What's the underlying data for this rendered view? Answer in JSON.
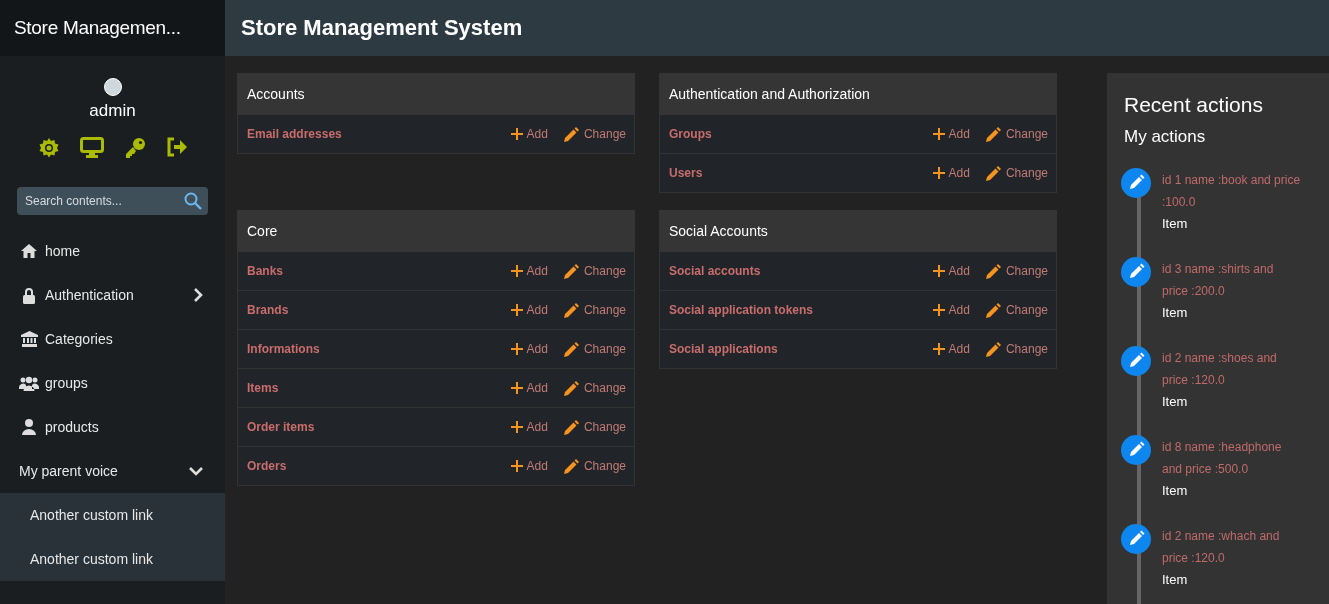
{
  "sidebar": {
    "brand": "Store Managemen...",
    "user": {
      "name": "admin"
    },
    "search": {
      "placeholder": "Search contents..."
    },
    "menu": [
      {
        "label": "home"
      },
      {
        "label": "Authentication",
        "expanded": false
      },
      {
        "label": "Categories"
      },
      {
        "label": "groups"
      },
      {
        "label": "products"
      },
      {
        "label": "My parent voice",
        "expanded": true,
        "children": [
          {
            "label": "Another custom link"
          },
          {
            "label": "Another custom link"
          }
        ]
      }
    ]
  },
  "header": {
    "title": "Store Management System"
  },
  "modules": [
    {
      "title": "Accounts",
      "models": [
        {
          "name": "Email addresses",
          "add": "Add",
          "change": "Change"
        }
      ]
    },
    {
      "title": "Authentication and Authorization",
      "models": [
        {
          "name": "Groups",
          "add": "Add",
          "change": "Change"
        },
        {
          "name": "Users",
          "add": "Add",
          "change": "Change"
        }
      ]
    },
    {
      "title": "Core",
      "models": [
        {
          "name": "Banks",
          "add": "Add",
          "change": "Change"
        },
        {
          "name": "Brands",
          "add": "Add",
          "change": "Change"
        },
        {
          "name": "Informations",
          "add": "Add",
          "change": "Change"
        },
        {
          "name": "Items",
          "add": "Add",
          "change": "Change"
        },
        {
          "name": "Order items",
          "add": "Add",
          "change": "Change"
        },
        {
          "name": "Orders",
          "add": "Add",
          "change": "Change"
        }
      ]
    },
    {
      "title": "Social Accounts",
      "models": [
        {
          "name": "Social accounts",
          "add": "Add",
          "change": "Change"
        },
        {
          "name": "Social application tokens",
          "add": "Add",
          "change": "Change"
        },
        {
          "name": "Social applications",
          "add": "Add",
          "change": "Change"
        }
      ]
    }
  ],
  "recent_actions": {
    "title": "Recent actions",
    "subtitle": "My actions",
    "items": [
      {
        "text": "id 1 name :book and price :100.0",
        "type": "Item"
      },
      {
        "text": "id 3 name :shirts and price :200.0",
        "type": "Item"
      },
      {
        "text": "id 2 name :shoes and price :120.0",
        "type": "Item"
      },
      {
        "text": "id 8 name :headphone and price :500.0",
        "type": "Item"
      },
      {
        "text": "id 2 name :whach and price :120.0",
        "type": "Item"
      }
    ]
  }
}
